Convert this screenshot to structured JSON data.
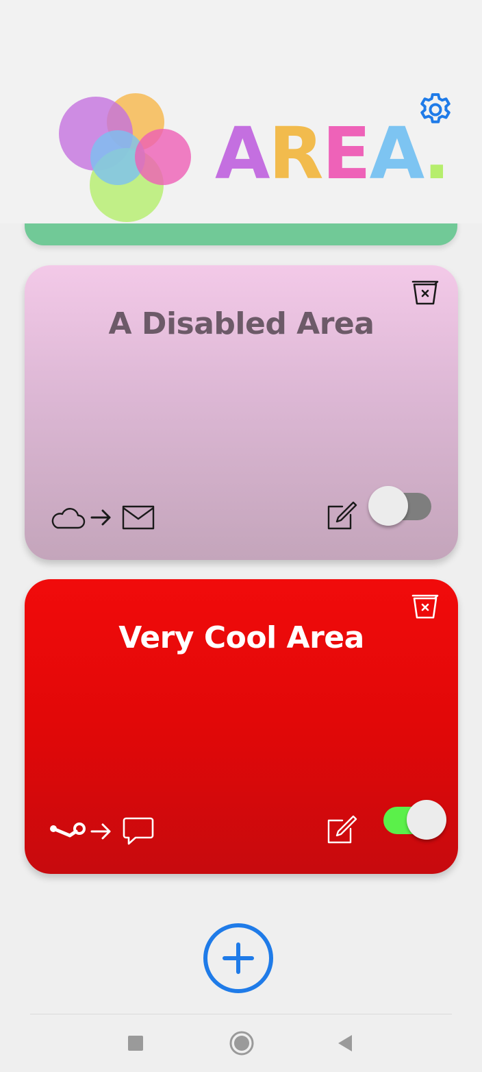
{
  "header": {
    "logo_letters": [
      {
        "char": "A",
        "color": "#c46fe0"
      },
      {
        "char": "R",
        "color": "#f2bb4d"
      },
      {
        "char": "E",
        "color": "#ee62b8"
      },
      {
        "char": "A",
        "color": "#7dc4f2"
      },
      {
        "char": ".",
        "color": "#b6ee6d"
      }
    ],
    "accent_color": "#1f7be8",
    "settings_icon": "gear-icon"
  },
  "previous_card": {
    "color": "#71c997"
  },
  "cards": [
    {
      "title": "A Disabled Area",
      "enabled": false,
      "action_icon": "cloud-icon",
      "reaction_icon": "mail-icon",
      "colors": [
        "#f3c9e8",
        "#c4a5bb"
      ]
    },
    {
      "title": "Very Cool Area",
      "enabled": true,
      "action_icon": "steam-icon",
      "reaction_icon": "chat-bubble-icon",
      "colors": [
        "#f10b0b",
        "#c70a0e"
      ]
    }
  ],
  "add_button_icon": "plus-circle-icon",
  "navbar": {
    "items": [
      "recent-apps",
      "home",
      "back"
    ]
  }
}
